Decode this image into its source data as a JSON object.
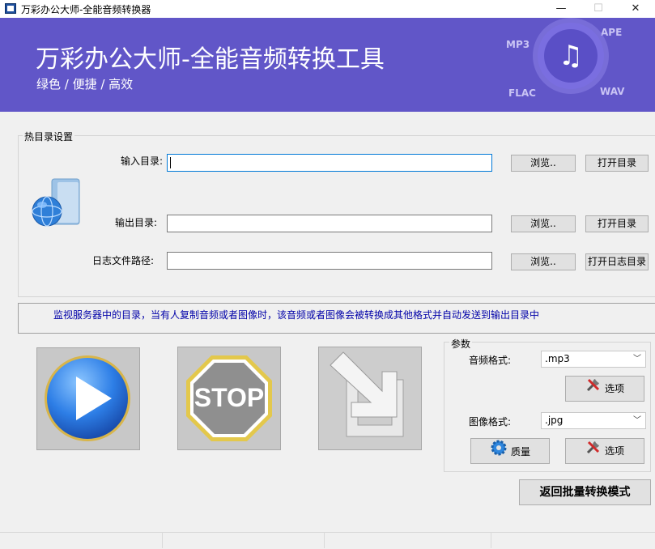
{
  "window": {
    "title": "万彩办公大师-全能音频转换器",
    "minimize": "—",
    "maximize": "☐",
    "close": "✕"
  },
  "banner": {
    "title": "万彩办公大师-全能音频转换工具",
    "subtitle": "绿色 / 便捷 / 高效",
    "formats": {
      "mp3": "MP3",
      "ape": "APE",
      "flac": "FLAC",
      "wav": "WAV"
    },
    "logo_icon": "music-note-icon"
  },
  "hot_dir": {
    "group_title": "热目录设置",
    "input_label": "输入目录:",
    "input_value": "",
    "output_label": "输出目录:",
    "output_value": "",
    "log_label": "日志文件路径:",
    "log_value": "",
    "browse": "浏览..",
    "open_dir": "打开目录",
    "open_log_dir": "打开日志目录"
  },
  "info": {
    "text": "监视服务器中的目录，当有人复制音频或者图像时，该音频或者图像会被转换成其他格式并自动发送到输出目录中"
  },
  "controls": {
    "play_icon": "play-icon",
    "stop_text": "STOP",
    "export_icon": "export-arrow-icon"
  },
  "params": {
    "group_title": "参数",
    "audio_label": "音频格式:",
    "audio_value": ".mp3",
    "image_label": "图像格式:",
    "image_value": ".jpg",
    "options": "选项",
    "quality": "质量"
  },
  "back_button": "返回批量转换模式",
  "colors": {
    "banner": "#6156c8",
    "accent_blue": "#0078d7",
    "info_text": "#0000a8"
  }
}
